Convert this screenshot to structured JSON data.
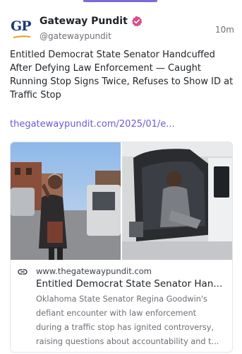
{
  "account": {
    "display_name": "Gateway Pundit",
    "handle": "@gatewaypundit",
    "avatar_text": "GP",
    "verified": true
  },
  "post": {
    "time": "10m",
    "text": "Entitled Democrat State Senator Handcuffed After Defying Law Enforcement — Caught Running Stop Signs Twice, Refuses to Show ID at Traffic Stop",
    "link_text": "thegatewaypundit.com/2025/01/e..."
  },
  "card": {
    "domain": "www.thegatewaypundit.com",
    "title": "Entitled Democrat State Senator Han...",
    "description_lines": [
      "Oklahoma State Senator Regina Goodwin's",
      "defiant encounter with law enforcement",
      "during a traffic stop has ignited controversy,",
      "raising questions about accountability and t..."
    ]
  },
  "colors": {
    "link": "#6c5ad6",
    "verified_badge": "#d94a8a",
    "brand_blue": "#1b3a7a",
    "brand_gold": "#e0a21a"
  },
  "icons": [
    "verified-badge-icon",
    "link-icon"
  ]
}
